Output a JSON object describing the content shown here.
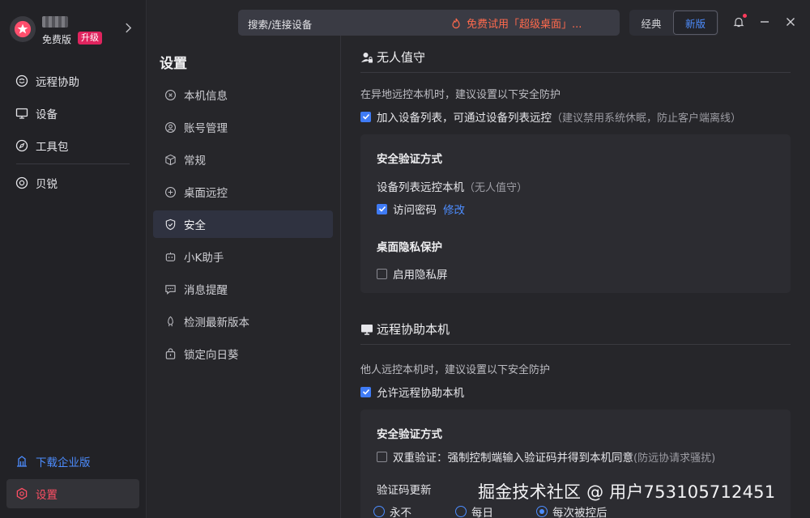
{
  "sidebar": {
    "edition": "免费版",
    "upgrade": "升级",
    "nav": [
      {
        "label": "远程协助"
      },
      {
        "label": "设备"
      },
      {
        "label": "工具包"
      },
      {
        "label": "贝锐"
      }
    ],
    "download": "下载企业版",
    "settings": "设置"
  },
  "topbar": {
    "search_label": "搜索/连接设备",
    "promo": "免费试用「超级桌面」...",
    "mode_classic": "经典",
    "mode_new": "新版"
  },
  "settings_menu": {
    "title": "设置",
    "items": [
      {
        "label": "本机信息"
      },
      {
        "label": "账号管理"
      },
      {
        "label": "常规"
      },
      {
        "label": "桌面远控"
      },
      {
        "label": "安全"
      },
      {
        "label": "小K助手"
      },
      {
        "label": "消息提醒"
      },
      {
        "label": "检测最新版本"
      },
      {
        "label": "锁定向日葵"
      }
    ]
  },
  "unattended": {
    "title": "无人值守",
    "hint": "在异地远控本机时，建议设置以下安全防护",
    "add_device": "加入设备列表，可通过设备列表远控",
    "add_device_note": "（建议禁用系统休眠，防止客户端离线）",
    "card": {
      "verify_title": "安全验证方式",
      "remote_sub": "设备列表远控本机",
      "remote_sub_note": "（无人值守）",
      "access_password": "访问密码",
      "modify": "修改",
      "privacy_title": "桌面隐私保护",
      "privacy_screen": "启用隐私屏"
    }
  },
  "assist": {
    "title": "远程协助本机",
    "hint": "他人远控本机时，建议设置以下安全防护",
    "allow": "允许远程协助本机",
    "card": {
      "verify_title": "安全验证方式",
      "double_verify": "双重验证：强制控制端输入验证码并得到本机同意",
      "double_verify_note": "(防远协请求骚扰)",
      "code_update": "验证码更新",
      "options": [
        "永不",
        "每日",
        "每次被控后"
      ]
    }
  },
  "watermark": "掘金技术社区 @ 用户753105712451"
}
